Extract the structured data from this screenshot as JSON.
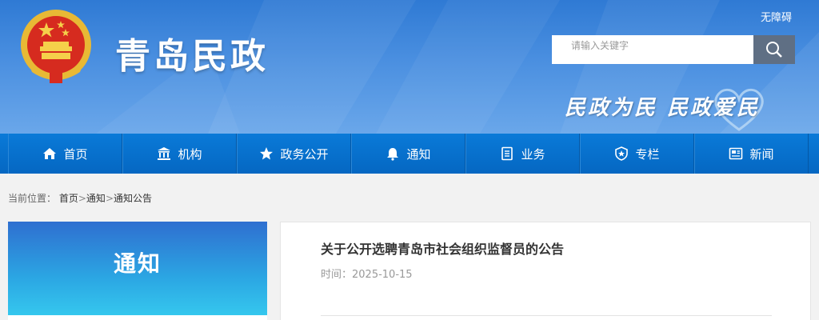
{
  "header": {
    "site_title": "青岛民政",
    "accessibility_link": "无障碍",
    "search_placeholder": "请输入关键字",
    "slogan": "民政为民  民政爱民"
  },
  "nav": {
    "items": [
      {
        "label": "首页",
        "icon": "home-icon"
      },
      {
        "label": "机构",
        "icon": "building-icon"
      },
      {
        "label": "政务公开",
        "icon": "star-icon"
      },
      {
        "label": "通知",
        "icon": "bell-icon"
      },
      {
        "label": "业务",
        "icon": "document-icon"
      },
      {
        "label": "专栏",
        "icon": "badge-icon"
      },
      {
        "label": "新闻",
        "icon": "news-icon"
      }
    ]
  },
  "breadcrumb": {
    "prefix": "当前位置：",
    "items": [
      "首页",
      "通知",
      "通知公告"
    ],
    "separator": ">"
  },
  "sidebar": {
    "title": "通知"
  },
  "article": {
    "title": "关于公开选聘青岛市社会组织监督员的公告",
    "date_label": "时间：",
    "date": "2025-10-15"
  },
  "colors": {
    "nav_bg": "#0a72d0",
    "header_bg": "#3f86dc",
    "sidebar_gradient_top": "#2f6fd0",
    "sidebar_gradient_bottom": "#35c7ee",
    "search_button": "#5f6f84"
  }
}
